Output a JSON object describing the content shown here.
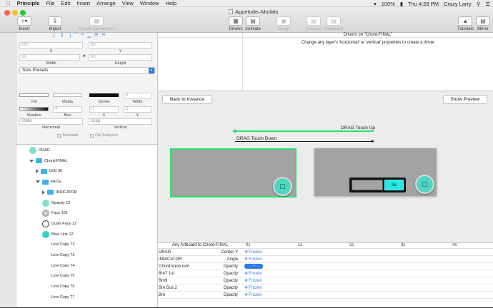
{
  "menubar": {
    "app": "Principle",
    "items": [
      "File",
      "Edit",
      "Insert",
      "Arrange",
      "View",
      "Window",
      "Help"
    ],
    "battery": "100%",
    "clock": "Thu 4:28 PM",
    "user": "Crazy Larry"
  },
  "toolbar": {
    "title": "Appetude–Modals",
    "insert": "Insert",
    "import": "Import",
    "create_component": "Create Component",
    "drivers": "Drivers",
    "animate": "Animate",
    "group": "Group",
    "forward": "Forward",
    "backward": "Backward",
    "tutorials": "Tutorials",
    "mirror": "Mirror"
  },
  "inspector": {
    "x_value": "260",
    "y_value": "66",
    "x_label": "X",
    "y_label": "Y",
    "w_value": "58",
    "h_value": "60",
    "w_label": "Width",
    "h_label": "Height",
    "size_presets": "Size Presets",
    "fill": "Fill",
    "media": "Media",
    "stroke": "Stroke",
    "width": "Width",
    "width_value": "0",
    "shadow": "Shadow",
    "blur": "Blur",
    "blur_value": "4",
    "sx_value": "0",
    "sy_value": "2",
    "sx_label": "X",
    "sy_label": "Y",
    "horizontal_value": "Static",
    "horizontal": "Horizontal",
    "vertical_value": "Drag",
    "vertical": "Vertical",
    "touchable": "Touchable",
    "clip_sublayers": "Clip Sublayers"
  },
  "layers": [
    {
      "name": "DRAG",
      "indent": 0,
      "icon": "circle"
    },
    {
      "name": "Chord-FINAL",
      "indent": 0,
      "icon": "folder",
      "open": true
    },
    {
      "name": "LED 30",
      "indent": 1,
      "icon": "folder",
      "open": false
    },
    {
      "name": "FACE",
      "indent": 1,
      "icon": "folder",
      "open": true
    },
    {
      "name": "INDICATOR",
      "indent": 2,
      "icon": "folder",
      "open": false
    },
    {
      "name": "Opacity 12",
      "indent": 2,
      "icon": "circle"
    },
    {
      "name": "Face 151",
      "indent": 2,
      "icon": "knob"
    },
    {
      "name": "Outer Face 12",
      "indent": 2,
      "icon": "ring"
    },
    {
      "name": "Blue Line 12",
      "indent": 2,
      "icon": "circle-dark"
    },
    {
      "name": "Line Copy 72",
      "indent": 2,
      "icon": "none"
    },
    {
      "name": "Line Copy 73",
      "indent": 2,
      "icon": "none"
    },
    {
      "name": "Line Copy 74",
      "indent": 2,
      "icon": "none"
    },
    {
      "name": "Line Copy 75",
      "indent": 2,
      "icon": "none"
    },
    {
      "name": "Line Copy 76",
      "indent": 2,
      "icon": "none"
    },
    {
      "name": "Line Copy 77",
      "indent": 2,
      "icon": "none"
    }
  ],
  "drivers": {
    "title": "Drivers on \"Chord-FINAL\"",
    "hint": "Change any layer's 'horizontal' or 'vertical' properties to create a driver"
  },
  "canvas": {
    "back_button": "Back to Instance",
    "show_preview": "Show Preview",
    "drag_touch_up": "DRAG Touch Up",
    "drag_touch_down": "DRAG Touch Down",
    "screen_label": "3e"
  },
  "timeline": {
    "header": "Any Artboard to Chord-FINAL",
    "ticks": [
      "0s",
      "1s",
      "2s",
      "3s",
      "4s"
    ],
    "rows": [
      {
        "name": "DRAG",
        "prop": "Center Y",
        "state": "Frozen"
      },
      {
        "name": "INDICATOR",
        "prop": "Angle",
        "state": "Frozen"
      },
      {
        "name": "Chord knob turn",
        "prop": "Opacity",
        "state": ""
      },
      {
        "name": "Bm7 1st",
        "prop": "Opacity",
        "state": "Frozen"
      },
      {
        "name": "Bm9",
        "prop": "Opacity",
        "state": "Frozen"
      },
      {
        "name": "Bm Sus 2",
        "prop": "Opacity",
        "state": "Frozen"
      },
      {
        "name": "Bm",
        "prop": "Opacity",
        "state": "Frozen"
      }
    ]
  },
  "colors": {
    "accent_green": "#2ee06b",
    "teal": "#4fd6c0",
    "frozen_blue": "#2a7ae2",
    "folder_blue": "#3db4ea"
  }
}
